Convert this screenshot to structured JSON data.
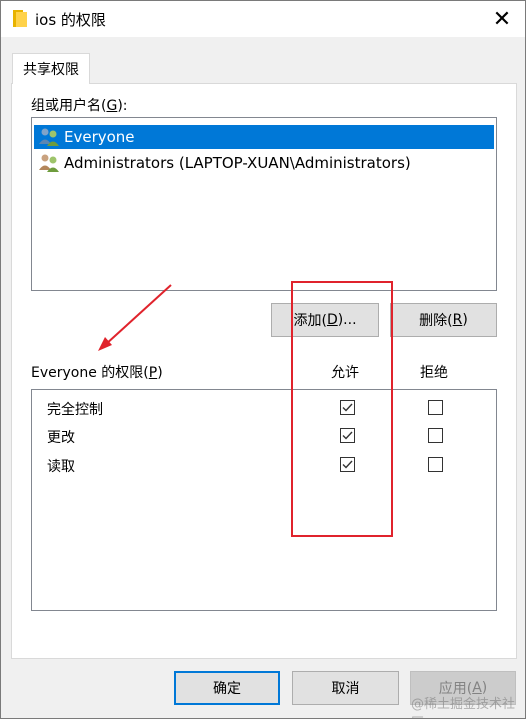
{
  "window": {
    "title": "ios 的权限",
    "close_glyph": "✕"
  },
  "tab": {
    "label": "共享权限"
  },
  "group_label": {
    "text": "组或用户名(",
    "hotkey": "G",
    "suffix": "):"
  },
  "users": [
    {
      "name": "Everyone",
      "selected": true
    },
    {
      "name": "Administrators (LAPTOP-XUAN\\Administrators)",
      "selected": false
    }
  ],
  "buttons": {
    "add": {
      "text": "添加(",
      "hotkey": "D",
      "suffix": ")..."
    },
    "remove": {
      "text": "删除(",
      "hotkey": "R",
      "suffix": ")"
    },
    "ok": "确定",
    "cancel": "取消",
    "apply": {
      "text": "应用(",
      "hotkey": "A",
      "suffix": ")"
    }
  },
  "permissions_label": {
    "text": "Everyone 的权限(",
    "hotkey": "P",
    "suffix": ")"
  },
  "columns": {
    "allow": "允许",
    "deny": "拒绝"
  },
  "permissions": [
    {
      "name": "完全控制",
      "allow": true,
      "deny": false
    },
    {
      "name": "更改",
      "allow": true,
      "deny": false
    },
    {
      "name": "读取",
      "allow": true,
      "deny": false
    }
  ],
  "watermark": "@稀土掘金技术社区",
  "colors": {
    "selection": "#0078d7",
    "annotation": "#e0232c"
  }
}
